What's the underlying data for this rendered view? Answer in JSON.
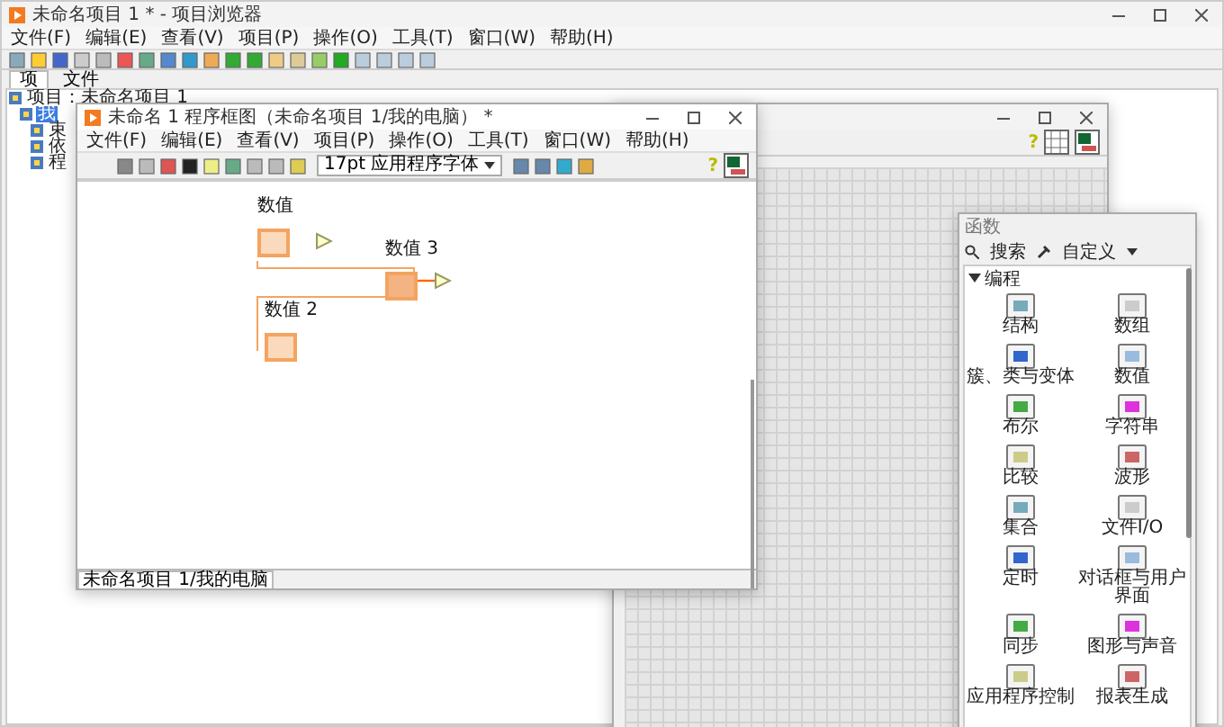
{
  "project_window": {
    "title": "未命名项目 1 * - 项目浏览器",
    "menu": [
      "文件(F)",
      "编辑(E)",
      "查看(V)",
      "项目(P)",
      "操作(O)",
      "工具(T)",
      "窗口(W)",
      "帮助(H)"
    ],
    "tabs": [
      {
        "label": "项",
        "selected": true
      },
      {
        "label": "文件",
        "selected": false
      }
    ],
    "tree": [
      {
        "label": "项目：未命名项目 1",
        "selected": false,
        "children": [
          {
            "label": "我",
            "selected": true,
            "children": [
              {
                "label": "束",
                "selected": false
              },
              {
                "label": "依",
                "selected": false
              },
              {
                "label": "程",
                "selected": false
              }
            ]
          }
        ]
      }
    ]
  },
  "block_diagram": {
    "title": "未命名 1 程序框图（未命名项目 1/我的电脑） *",
    "menu": [
      "文件(F)",
      "编辑(E)",
      "查看(V)",
      "项目(P)",
      "操作(O)",
      "工具(T)",
      "窗口(W)",
      "帮助(H)"
    ],
    "font": "17pt 应用程序字体",
    "help": "?",
    "nodes": [
      {
        "label": "数值",
        "kind": "control"
      },
      {
        "label": "数值 3",
        "kind": "indicator"
      },
      {
        "label": "数值 2",
        "kind": "control"
      }
    ],
    "status": "未命名项目 1/我的电脑"
  },
  "front_panel": {
    "help": "?"
  },
  "palette": {
    "title": "函数",
    "search": "搜索",
    "customize": "自定义",
    "category": "编程",
    "expanded": true,
    "items": [
      {
        "label": "结构"
      },
      {
        "label": "数组"
      },
      {
        "label": "簇、类与变体"
      },
      {
        "label": "数值"
      },
      {
        "label": "布尔"
      },
      {
        "label": "字符串"
      },
      {
        "label": "比较"
      },
      {
        "label": "波形"
      },
      {
        "label": "集合"
      },
      {
        "label": "文件I/O"
      },
      {
        "label": "定时"
      },
      {
        "label": "对话框与用户界面"
      },
      {
        "label": "同步"
      },
      {
        "label": "图形与声音"
      },
      {
        "label": "应用程序控制"
      },
      {
        "label": "报表生成"
      }
    ]
  }
}
